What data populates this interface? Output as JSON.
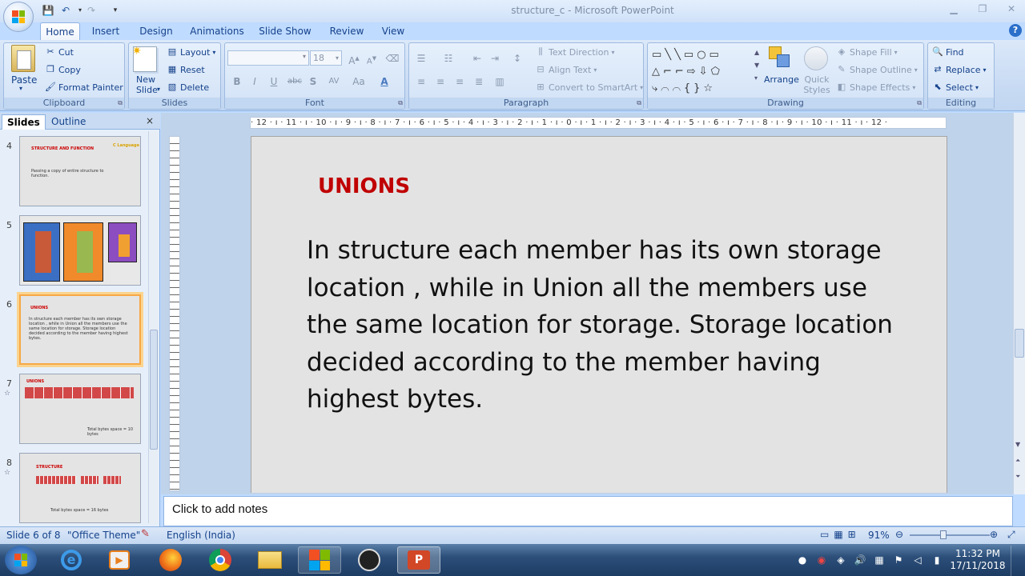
{
  "window": {
    "title": "structure_c - Microsoft PowerPoint"
  },
  "ribbon_tabs": [
    "Home",
    "Insert",
    "Design",
    "Animations",
    "Slide Show",
    "Review",
    "View"
  ],
  "clipboard": {
    "paste": "Paste",
    "cut": "Cut",
    "copy": "Copy",
    "format_painter": "Format Painter",
    "label": "Clipboard"
  },
  "slides_group": {
    "new_slide": "New Slide",
    "new_slide_arrow": "▾",
    "layout": "Layout",
    "reset": "Reset",
    "delete": "Delete",
    "label": "Slides"
  },
  "font_group": {
    "size": "18",
    "label": "Font",
    "bold": "B",
    "italic": "I",
    "underline": "U",
    "strike": "abc",
    "shadow": "S",
    "spacing": "AV",
    "case": "Aa"
  },
  "paragraph_group": {
    "text_direction": "Text Direction",
    "align_text": "Align Text",
    "convert": "Convert to SmartArt",
    "label": "Paragraph"
  },
  "drawing_group": {
    "arrange": "Arrange",
    "quick_styles": "Quick Styles",
    "shape_fill": "Shape Fill",
    "shape_outline": "Shape Outline",
    "shape_effects": "Shape Effects",
    "label": "Drawing"
  },
  "editing_group": {
    "find": "Find",
    "replace": "Replace",
    "select": "Select",
    "label": "Editing"
  },
  "pane_tabs": {
    "slides": "Slides",
    "outline": "Outline"
  },
  "thumbnails": [
    {
      "num": "4",
      "title": "STRUCTURE AND FUNCTION",
      "tag": "C Language",
      "body": "Passing a copy of entire structure to function."
    },
    {
      "num": "5"
    },
    {
      "num": "6",
      "title": "UNIONS",
      "body": "In structure each member has its own storage location , while in Union all the members use the same location for storage. Storage location decided according to the member having highest bytes."
    },
    {
      "num": "7",
      "title": "UNIONS",
      "body": "Total bytes space = 10 bytes"
    },
    {
      "num": "8",
      "title": "STRUCTURE",
      "body": "Total bytes space = 16 bytes"
    }
  ],
  "ruler": {
    "h": "· 12 · ı · 11 · ı · 10 · ı · 9 · ı · 8 · ı · 7 · ı · 6 · ı · 5 · ı · 4 · ı · 3 · ı · 2 · ı · 1 · ı · 0 · ı · 1 · ı · 2 · ı · 3 · ı · 4 · ı · 5 · ı · 6 · ı · 7 · ı · 8 · ı · 9 · ı · 10 · ı · 11 · ı · 12 ·"
  },
  "slide": {
    "title": "UNIONS",
    "body": "In structure each member has its own storage location , while in Union all the members use the same location for storage. Storage location decided according to the member having highest bytes."
  },
  "notes": {
    "placeholder": "Click to add notes"
  },
  "status": {
    "slide": "Slide 6 of 8",
    "theme": "\"Office Theme\"",
    "language": "English (India)",
    "zoom": "91%"
  },
  "clock": {
    "time": "11:32 PM",
    "date": "17/11/2018"
  },
  "colors": {
    "accent": "#15428b",
    "title_red": "#c00000",
    "selected_thumb": "#f7a845"
  }
}
